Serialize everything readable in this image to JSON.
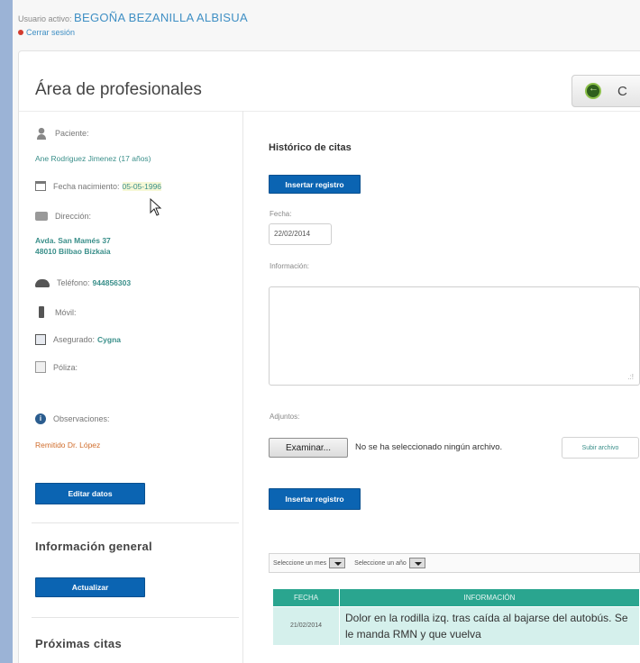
{
  "topbar": {
    "user_prefix": "Usuario activo:",
    "user_name": "BEGOÑA BEZANILLA ALBISUA",
    "logout": "Cerrar sesión"
  },
  "header": {
    "title": "Área de profesionales",
    "back_button_letter": "C"
  },
  "patient": {
    "patient_label": "Paciente:",
    "patient_value": "Ane Rodriguez Jimenez (17 años)",
    "birth_label": "Fecha nacimiento:",
    "birth_value": "05-05-1996",
    "address_label": "Dirección:",
    "address_line1": "Avda. San Mamés 37",
    "address_line2": "48010 Bilbao Bizkaia",
    "phone_label": "Teléfono:",
    "phone_value": "944856303",
    "mobile_label": "Móvil:",
    "insured_label": "Asegurado:",
    "insured_value": "Cygna",
    "policy_label": "Póliza:",
    "notes_label": "Observaciones:",
    "notes_value": "Remitido Dr. López",
    "edit_button": "Editar datos"
  },
  "general": {
    "title": "Información general",
    "update_button": "Actualizar"
  },
  "upcoming": {
    "title": "Próximas citas"
  },
  "history": {
    "title": "Histórico de citas",
    "insert_button_top": "Insertar registro",
    "date_label": "Fecha:",
    "date_value": "22/02/2014",
    "info_label": "Información:",
    "attachments_label": "Adjuntos:",
    "browse_button": "Examinar...",
    "no_file_text": "No se ha seleccionado ningún archivo.",
    "upload_button": "Subir archivo",
    "insert_button_bottom": "Insertar registro",
    "month_select": "Seleccione un mes",
    "year_select": "Seleccione un año",
    "columns": [
      "FECHA",
      "INFORMACIÓN"
    ],
    "rows": [
      {
        "date": "21/02/2014",
        "info": "Dolor en la rodilla izq. tras caída al bajarse del autobús. Se le manda RMN y que vuelva"
      }
    ]
  },
  "colors": {
    "accent_blue": "#0b64b2",
    "table_header": "#2aa58f",
    "table_row": "#d5f0ec",
    "link_teal": "#3a8f8a",
    "notes_orange": "#d06d2c"
  }
}
